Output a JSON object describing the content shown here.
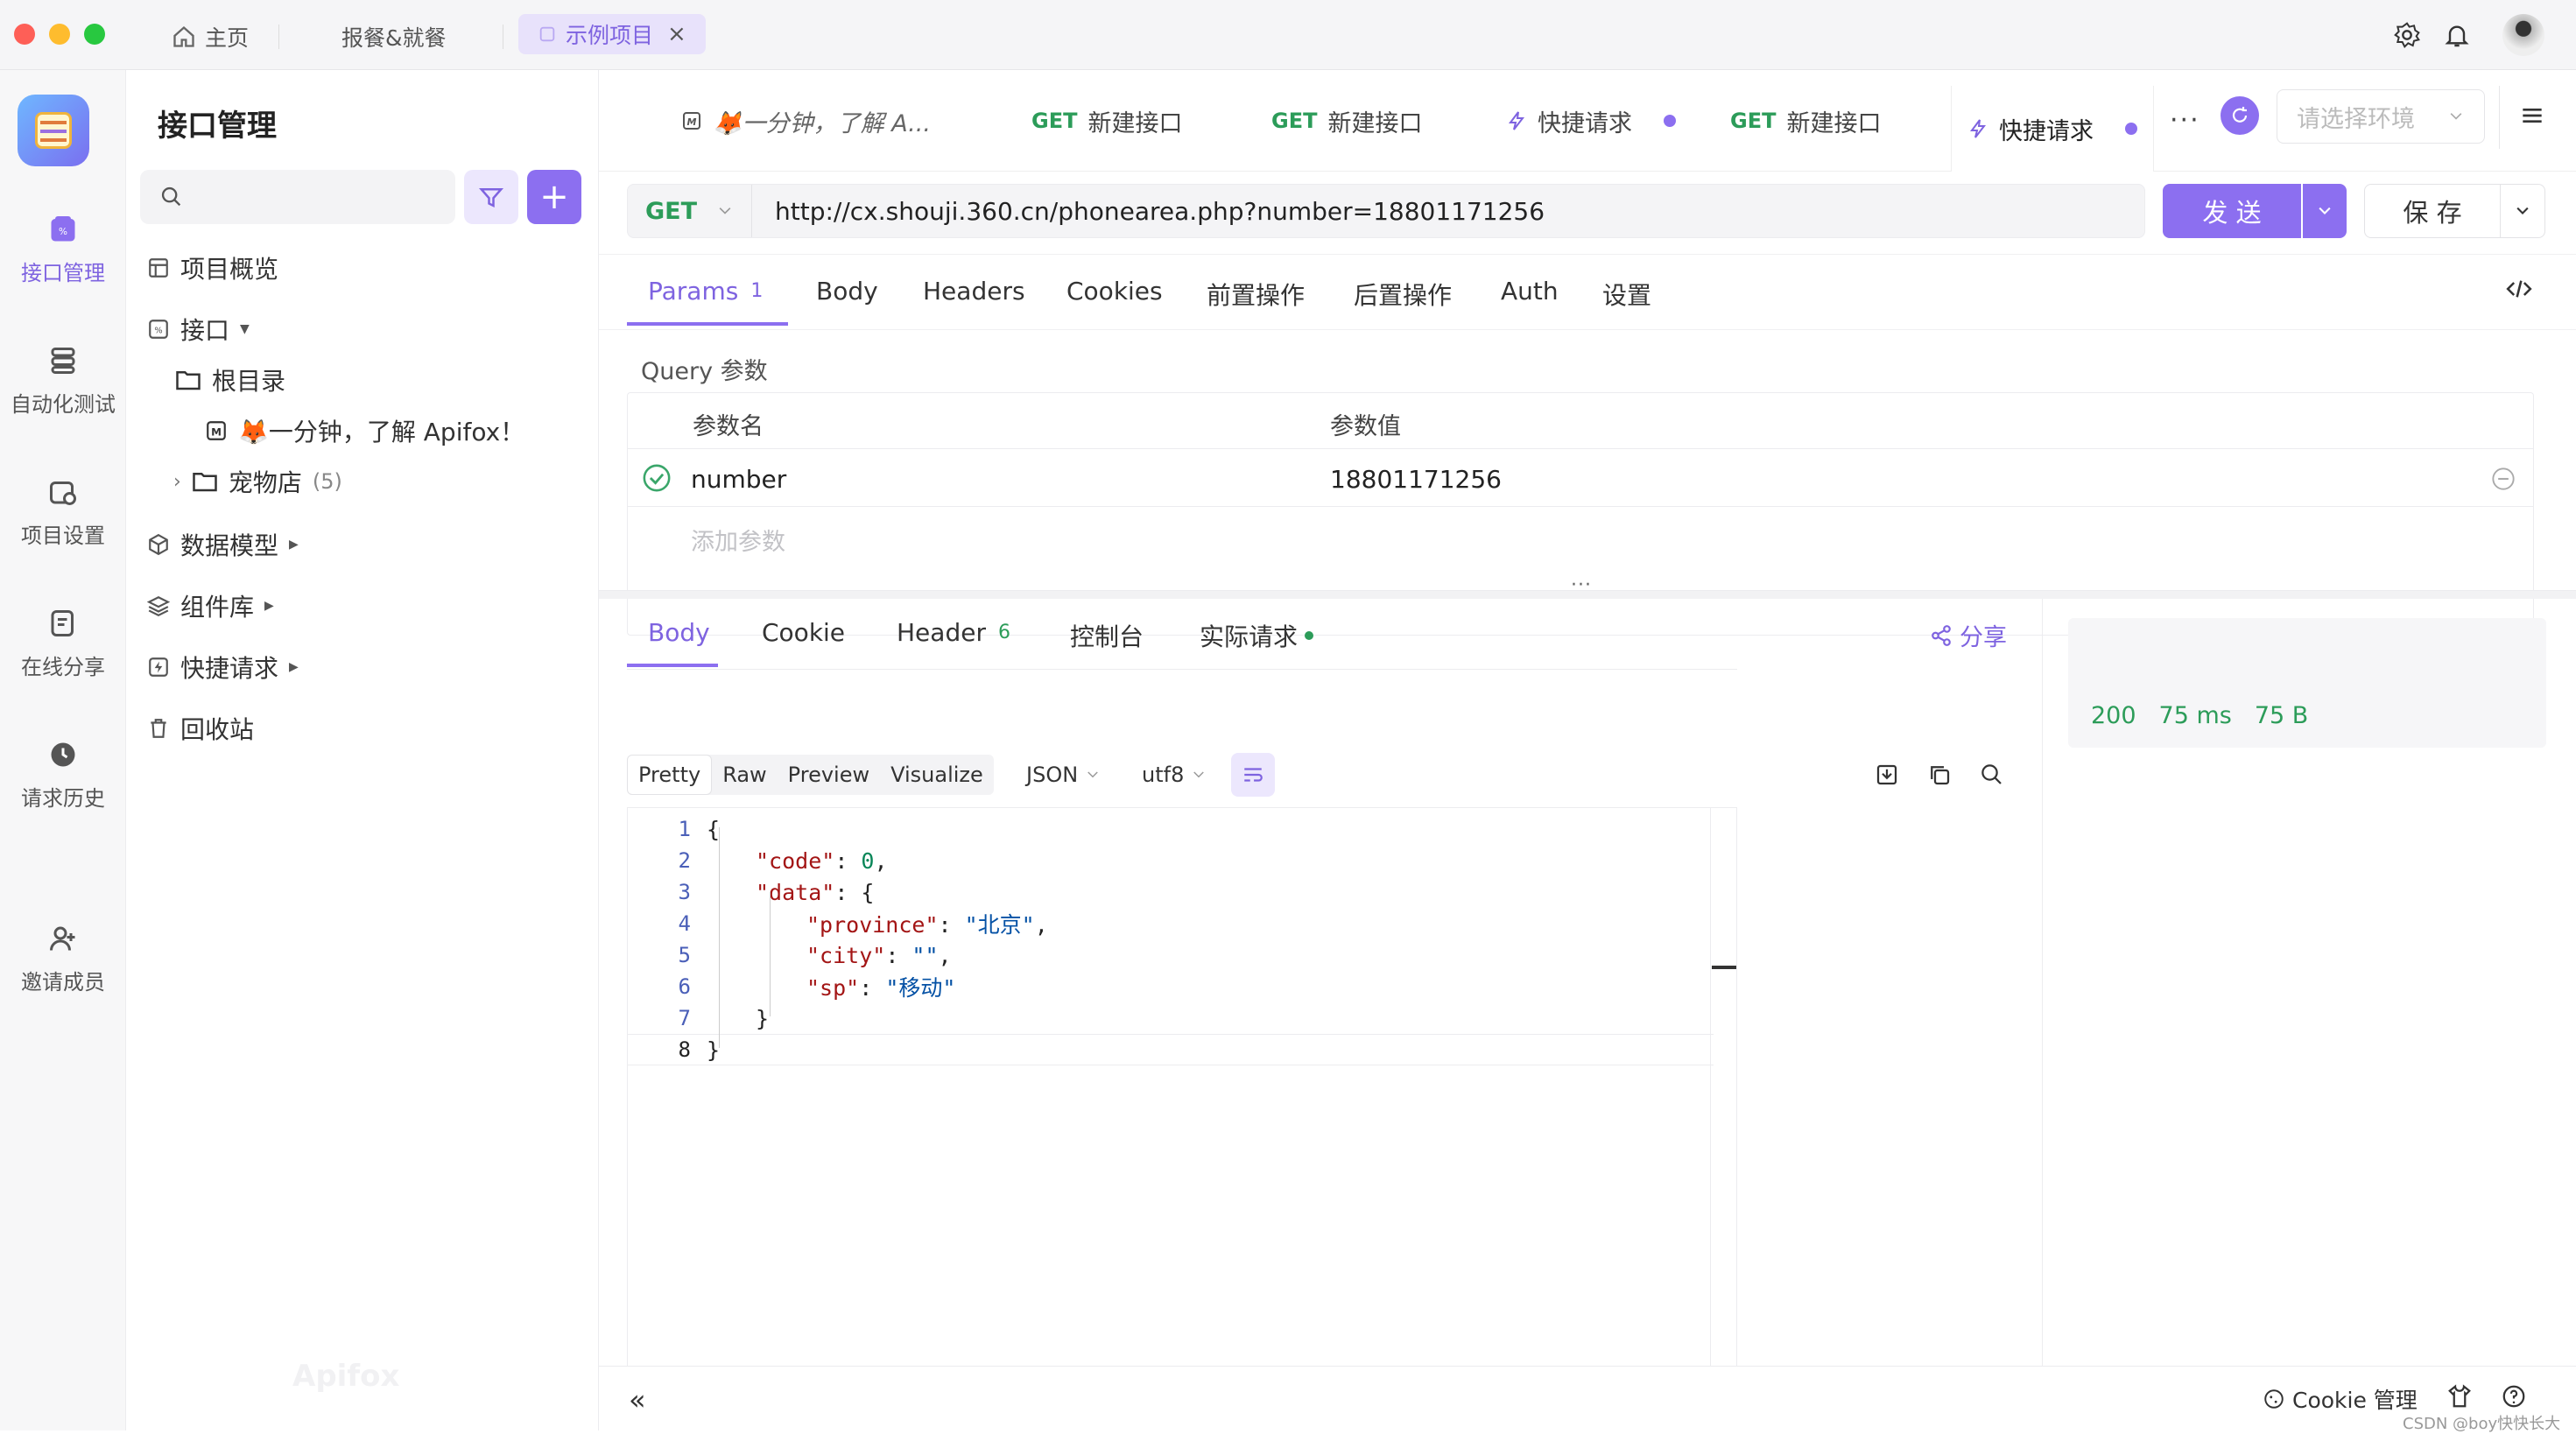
{
  "window": {
    "tabs": [
      {
        "label": "主页"
      },
      {
        "label": "报餐&就餐"
      },
      {
        "label": "示例项目"
      }
    ]
  },
  "nav": {
    "items": [
      {
        "label": "接口管理"
      },
      {
        "label": "自动化测试"
      },
      {
        "label": "项目设置"
      },
      {
        "label": "在线分享"
      },
      {
        "label": "请求历史"
      },
      {
        "label": "邀请成员"
      }
    ]
  },
  "panel": {
    "title": "接口管理",
    "watermark": "Apifox",
    "tree": {
      "overview": "项目概览",
      "api": "接口",
      "root": "根目录",
      "doc": "🦊一分钟，了解 Apifox！",
      "petstore": "宠物店",
      "petstore_count": "(5)",
      "models": "数据模型",
      "components": "组件库",
      "quick": "快捷请求",
      "trash": "回收站"
    }
  },
  "tabs": [
    {
      "label": "🦊一分钟，了解 A..."
    },
    {
      "method": "GET",
      "label": "新建接口"
    },
    {
      "method": "GET",
      "label": "新建接口"
    },
    {
      "label": "快捷请求"
    },
    {
      "method": "GET",
      "label": "新建接口"
    },
    {
      "label": "快捷请求"
    }
  ],
  "env": {
    "placeholder": "请选择环境"
  },
  "request": {
    "method": "GET",
    "url": "http://cx.shouji.360.cn/phonearea.php?number=18801171256",
    "send": "发 送",
    "save": "保 存"
  },
  "req_tabs": {
    "params": "Params",
    "params_count": "1",
    "body": "Body",
    "headers": "Headers",
    "cookies": "Cookies",
    "pre": "前置操作",
    "post": "后置操作",
    "auth": "Auth",
    "settings": "设置"
  },
  "query": {
    "title": "Query 参数",
    "col_name": "参数名",
    "col_value": "参数值",
    "rows": [
      {
        "name": "number",
        "value": "18801171256"
      }
    ],
    "add_placeholder": "添加参数"
  },
  "resp_tabs": {
    "body": "Body",
    "cookie": "Cookie",
    "header": "Header",
    "header_count": "6",
    "console": "控制台",
    "actual": "实际请求",
    "share": "分享"
  },
  "resp_fmt": {
    "pretty": "Pretty",
    "raw": "Raw",
    "preview": "Preview",
    "visualize": "Visualize",
    "json": "JSON",
    "enc": "utf8"
  },
  "status": {
    "code": "200",
    "time": "75 ms",
    "size": "75 B"
  },
  "code": {
    "l1": "{",
    "k_code": "\"code\"",
    "v_code": "0",
    "k_data": "\"data\"",
    "k_province": "\"province\"",
    "v_province": "\"北京\"",
    "k_city": "\"city\"",
    "v_city": "\"\"",
    "k_sp": "\"sp\"",
    "v_sp": "\"移动\"",
    "close_inner": "}",
    "close_outer": "}"
  },
  "footer": {
    "cookie": "Cookie 管理",
    "credit": "CSDN @boy快快长大"
  },
  "colors": {
    "accent": "#8c6ff0",
    "green": "#2c9c59"
  }
}
